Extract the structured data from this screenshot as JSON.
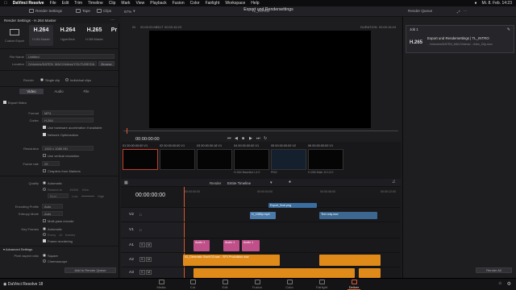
{
  "menubar": {
    "app": "DaVinci Resolve",
    "items": [
      "File",
      "Edit",
      "Trim",
      "Timeline",
      "Clip",
      "Mark",
      "View",
      "Playback",
      "Fusion",
      "Color",
      "Fairlight",
      "Workspace",
      "Help"
    ],
    "clock": "Mi. 8. Feb. 14:23"
  },
  "toolbar": {
    "render_settings": "Render Settings",
    "tape": "Tape",
    "clips": "Clips",
    "zoom": "67%",
    "timeline_name": "TL_INTRO",
    "title": "Export und Rendersettings",
    "render_queue": "Render Queue"
  },
  "render_settings": {
    "header": "Render Settings - H.264 Master",
    "presets": [
      {
        "big": "",
        "small": "Custom Export"
      },
      {
        "big": "H.264",
        "small": "H.264 Master"
      },
      {
        "big": "H.264",
        "small": "HyperDeck"
      },
      {
        "big": "H.265",
        "small": "H.265 Master"
      },
      {
        "big": "Pr",
        "small": ""
      }
    ],
    "filename_label": "File Name",
    "filename_value": "Untitled",
    "location_label": "Location",
    "location_value": "/Volumes/DATEN_MAC/Videos/YOUTUBE/DA",
    "browse": "Browse",
    "render_label": "Render",
    "single_clip": "Single clip",
    "individual_clips": "Individual clips",
    "tabs": [
      "Video",
      "Audio",
      "File"
    ],
    "export_video": "Export Video",
    "format_label": "Format",
    "format_value": "MP4",
    "codec_label": "Codec",
    "codec_value": "H.264",
    "hw_accel": "Use hardware acceleration if available",
    "network_opt": "Network Optimization",
    "resolution_label": "Resolution",
    "resolution_value": "1920 x 1080 HD",
    "vertical_res": "Use vertical resolution",
    "framerate_label": "Frame rate",
    "framerate_value": "25",
    "chapters": "Chapters from Markers",
    "quality_label": "Quality",
    "quality_auto": "Automatic",
    "restrict_to": "Restrict to",
    "restrict_val": "10000",
    "restrict_unit": "Kb/s",
    "best": "Best",
    "quality_low": "Low",
    "quality_high": "High",
    "encoding_profile_label": "Encoding Profile",
    "encoding_profile_value": "Auto",
    "entropy_label": "Entropy Mode",
    "entropy_value": "Auto",
    "multipass": "Multi-pass encode",
    "keyframes_label": "Key Frames",
    "keyframes_auto": "Automatic",
    "every": "Every",
    "every_val": "12",
    "every_unit": "frames",
    "frame_reorder": "Frame reordering",
    "advanced": "Advanced Settings",
    "pixel_aspect_label": "Pixel aspect ratio",
    "pixel_square": "Square",
    "pixel_cinemascope": "Cinemascope",
    "add_to_queue": "Add to Render Queue"
  },
  "viewer": {
    "tc_in": "00:00:00:00",
    "tc_out": "00:00:16:23",
    "out_label": "OUT",
    "duration_label": "DURATION",
    "duration": "00:00:16:24",
    "tc_in2": "00:00:00:00",
    "playhead_tc": "00:00:00:00"
  },
  "clips": [
    {
      "num": "01",
      "tc": "00:00:00:00",
      "track": "V1",
      "name": ""
    },
    {
      "num": "02",
      "tc": "00:00:00:00",
      "track": "V1",
      "name": ""
    },
    {
      "num": "03",
      "tc": "00:00:00:18",
      "track": "V1",
      "name": ""
    },
    {
      "num": "04",
      "tc": "00:00:00:00",
      "track": "V1",
      "name": "H.264 Baseline L4.0"
    },
    {
      "num": "05",
      "tc": "00:00:00:00",
      "track": "V2",
      "name": "PNG"
    },
    {
      "num": "06",
      "tc": "00:00:00:00",
      "track": "V1",
      "name": "H.265 Main 10 L5.0"
    }
  ],
  "timeline": {
    "render_label": "Render",
    "render_value": "Entire Timeline",
    "tc": "00:00:00:00",
    "ruler": [
      "00:00:00:00",
      "00:00:04:00",
      "00:00:08:00",
      "00:00:12:00"
    ],
    "tracks": [
      {
        "id": "V2",
        "segments": [
          {
            "label": "Export_final.png",
            "color": "#3a6ea0"
          },
          {
            "label": "H_1080p.mp4",
            "color": "#4a7aaa"
          },
          {
            "label": "Text only.mov",
            "color": "#3c6790"
          }
        ]
      },
      {
        "id": "V1",
        "segments": []
      },
      {
        "id": "A1",
        "segments": [
          {
            "label": "Audio 1",
            "color": "#c0508a"
          },
          {
            "label": "Audio 1",
            "color": "#c0508a"
          },
          {
            "label": "Audio 1",
            "color": "#c0508a"
          }
        ]
      },
      {
        "id": "A2",
        "segments": [
          {
            "label": "01_Cinematic Swell 03.wav - SFX Produktion.wav",
            "color": "#e08a1a"
          },
          {
            "label": "",
            "color": "#e08a1a"
          }
        ]
      },
      {
        "id": "A3",
        "segments": [
          {
            "label": "",
            "color": "#e08a1a"
          },
          {
            "label": "",
            "color": "#e08a1a"
          }
        ]
      }
    ]
  },
  "render_queue": {
    "job": "Job 1",
    "job_title": "Export und Rendersettings | TL_INTRO",
    "job_path": ".../Volumes/DATEN_MAC/Videos/.../Intro_Clip.mov",
    "job_codec": "H.265",
    "render_all": "Render All"
  },
  "pages": [
    {
      "label": "Media"
    },
    {
      "label": "Cut"
    },
    {
      "label": "Edit"
    },
    {
      "label": "Fusion"
    },
    {
      "label": "Color"
    },
    {
      "label": "Fairlight"
    },
    {
      "label": "Deliver"
    }
  ],
  "bottom_app": "DaVinci Resolve 18"
}
